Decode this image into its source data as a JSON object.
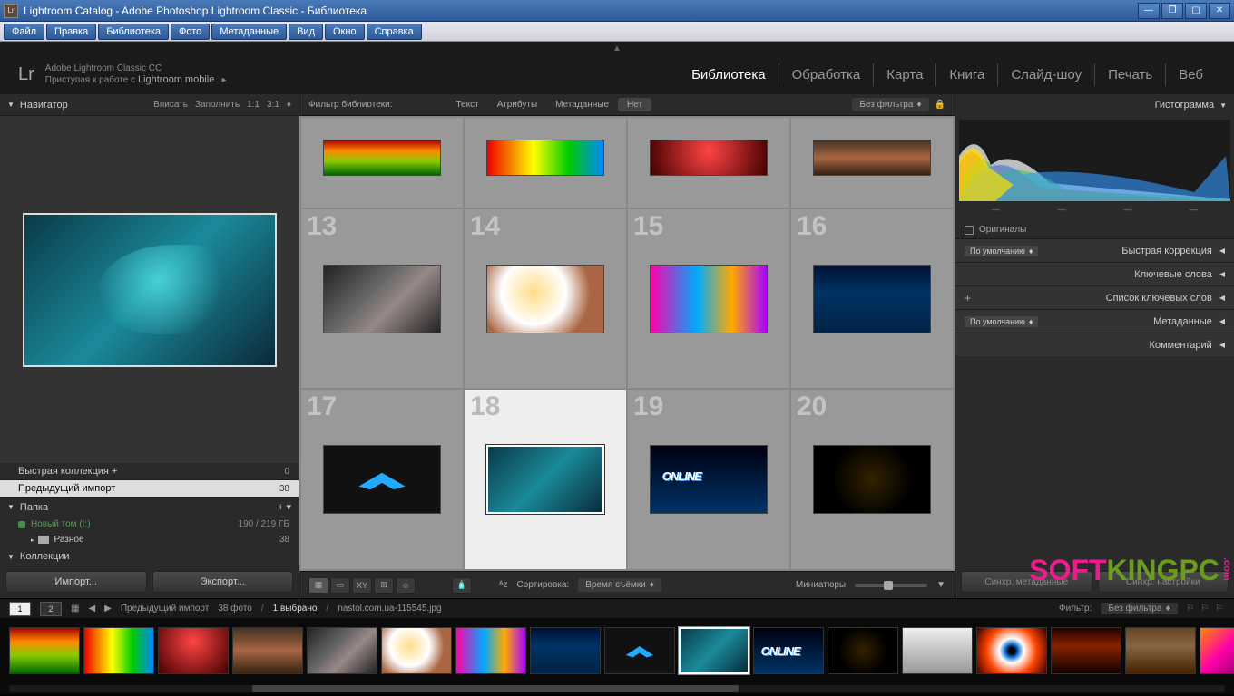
{
  "title": "Lightroom Catalog - Adobe Photoshop Lightroom Classic - Библиотека",
  "menu": [
    "Файл",
    "Правка",
    "Библиотека",
    "Фото",
    "Метаданные",
    "Вид",
    "Окно",
    "Справка"
  ],
  "header": {
    "app": "Adobe Lightroom Classic CC",
    "sub1": "Приступая к работе с ",
    "sub2": "Lightroom mobile"
  },
  "modules": [
    "Библиотека",
    "Обработка",
    "Карта",
    "Книга",
    "Слайд-шоу",
    "Печать",
    "Веб"
  ],
  "activeModule": 0,
  "navigator": {
    "label": "Навигатор",
    "ratios": [
      "Вписать",
      "Заполнить",
      "1:1",
      "3:1"
    ]
  },
  "catalog": {
    "quick": "Быстрая коллекция",
    "quickCount": "0",
    "prev": "Предыдущий импорт",
    "prevCount": "38",
    "folder": "Папка",
    "disk": "Новый том (I:)",
    "diskSize": "190 / 219 ГБ",
    "sub": "Разное",
    "subCount": "38",
    "collections": "Коллекции"
  },
  "leftBtns": {
    "import": "Импорт...",
    "export": "Экспорт..."
  },
  "filterBar": {
    "label": "Фильтр библиотеки:",
    "tabs": [
      "Текст",
      "Атрибуты",
      "Метаданные",
      "Нет"
    ],
    "active": 3,
    "none": "Без фильтра"
  },
  "gridNums": [
    [
      "",
      "",
      "",
      ""
    ],
    [
      "13",
      "14",
      "15",
      "16"
    ],
    [
      "17",
      "18",
      "19",
      "20"
    ]
  ],
  "selectedCell": [
    2,
    1
  ],
  "toolbar": {
    "sort": "Сортировка:",
    "sortVal": "Время съёмки",
    "thumb": "Миниатюры"
  },
  "right": {
    "histo": "Гистограмма",
    "histoMeta": [
      "—",
      "—",
      "—",
      "—"
    ],
    "orig": "Оригиналы",
    "default": "По умолчанию",
    "quick": "Быстрая коррекция",
    "keywords": "Ключевые слова",
    "keylist": "Список ключевых слов",
    "meta": "Метаданные",
    "comment": "Комментарий"
  },
  "sync": {
    "meta": "Синхр. метаданные",
    "settings": "Синхр. настройки"
  },
  "filmHeader": {
    "n1": "1",
    "n2": "2",
    "prev": "Предыдущий импорт",
    "count": "38 фото",
    "sel": "1 выбрано",
    "file": "nastol.com.ua-115545.jpg",
    "filter": "Фильтр:",
    "filterVal": "Без фильтра"
  },
  "watermark": {
    "p1": "SOFT",
    "p2": "KINGPC",
    "dot": ".com"
  }
}
